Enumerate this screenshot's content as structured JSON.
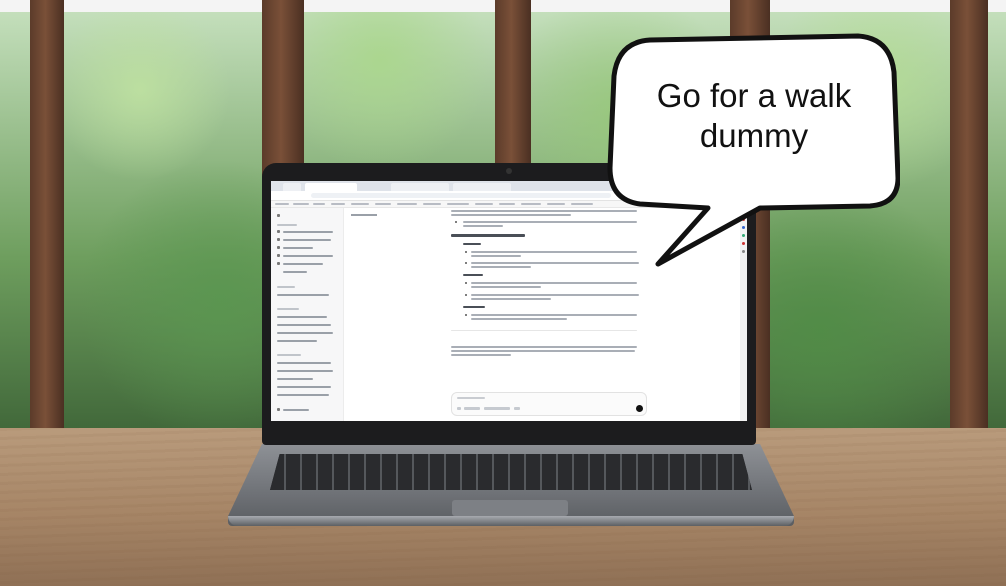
{
  "speech_bubble": {
    "line1": "Go for a walk",
    "line2": "dummy"
  },
  "colors": {
    "bubble_fill": "#ffffff",
    "bubble_outline": "#111111",
    "laptop_bezel": "#1c1c1e",
    "table": "#a68566"
  }
}
